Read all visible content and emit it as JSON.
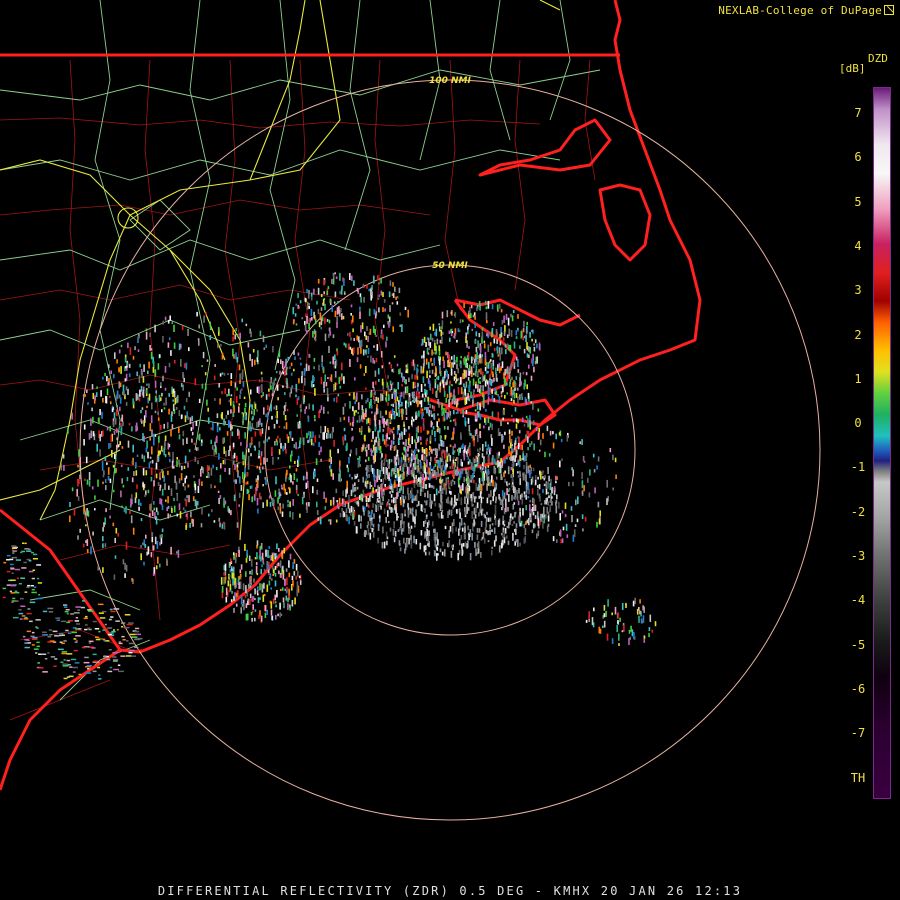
{
  "credit": "NEXLAB-College of DuPage",
  "credit_icon": "external-link-icon",
  "legend": {
    "product": "DZD",
    "unit": "[dB]",
    "ticks": [
      "7",
      "6",
      "5",
      "4",
      "3",
      "2",
      "1",
      "0",
      "-1",
      "-2",
      "-3",
      "-4",
      "-5",
      "-6",
      "-7",
      "TH"
    ]
  },
  "range_rings": [
    "100 NMI",
    "50 NMI"
  ],
  "footer": "DIFFERENTIAL REFLECTIVITY (ZDR) 0.5 DEG - KMHX 20 JAN 26 12:13",
  "colors": {
    "state_border": "#ff2020",
    "county_lines": "#b01818",
    "highways": "#e8e840",
    "roads": "#9ad29a",
    "range_ring": "#e8b0a0",
    "text": "#f0e040"
  }
}
